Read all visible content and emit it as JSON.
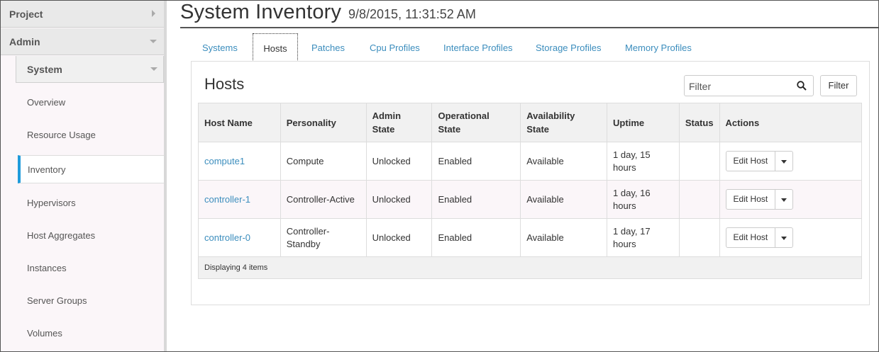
{
  "sidebar": {
    "sections": [
      {
        "label": "Project"
      },
      {
        "label": "Admin"
      }
    ],
    "subsection": {
      "label": "System"
    },
    "items": [
      {
        "label": "Overview"
      },
      {
        "label": "Resource Usage"
      },
      {
        "label": "Inventory"
      },
      {
        "label": "Hypervisors"
      },
      {
        "label": "Host Aggregates"
      },
      {
        "label": "Instances"
      },
      {
        "label": "Server Groups"
      },
      {
        "label": "Volumes"
      }
    ]
  },
  "header": {
    "title": "System Inventory",
    "timestamp": "9/8/2015, 11:31:52 AM"
  },
  "tabs": [
    {
      "label": "Systems"
    },
    {
      "label": "Hosts"
    },
    {
      "label": "Patches"
    },
    {
      "label": "Cpu Profiles"
    },
    {
      "label": "Interface Profiles"
    },
    {
      "label": "Storage Profiles"
    },
    {
      "label": "Memory Profiles"
    }
  ],
  "panel": {
    "title": "Hosts",
    "filter_placeholder": "Filter",
    "filter_button": "Filter"
  },
  "table": {
    "headers": {
      "host_name": "Host Name",
      "personality": "Personality",
      "admin_state_1": "Admin",
      "admin_state_2": "State",
      "operational_state_1": "Operational",
      "operational_state_2": "State",
      "availability_state_1": "Availability",
      "availability_state_2": "State",
      "uptime": "Uptime",
      "status": "Status",
      "actions": "Actions"
    },
    "rows": [
      {
        "host_name": "compute1",
        "personality_1": "Compute",
        "personality_2": "",
        "admin_state": "Unlocked",
        "operational_state": "Enabled",
        "availability_state": "Available",
        "uptime_1": "1 day, 15",
        "uptime_2": "hours",
        "status": "",
        "action": "Edit Host"
      },
      {
        "host_name": "controller-1",
        "personality_1": "Controller-Active",
        "personality_2": "",
        "admin_state": "Unlocked",
        "operational_state": "Enabled",
        "availability_state": "Available",
        "uptime_1": "1 day, 16",
        "uptime_2": "hours",
        "status": "",
        "action": "Edit Host"
      },
      {
        "host_name": "controller-0",
        "personality_1": "Controller-",
        "personality_2": "Standby",
        "admin_state": "Unlocked",
        "operational_state": "Enabled",
        "availability_state": "Available",
        "uptime_1": "1 day, 17",
        "uptime_2": "hours",
        "status": "",
        "action": "Edit Host"
      }
    ],
    "footer": "Displaying 4 items"
  },
  "colors": {
    "accent": "#1f9bdb",
    "link": "#3b8dbd"
  }
}
